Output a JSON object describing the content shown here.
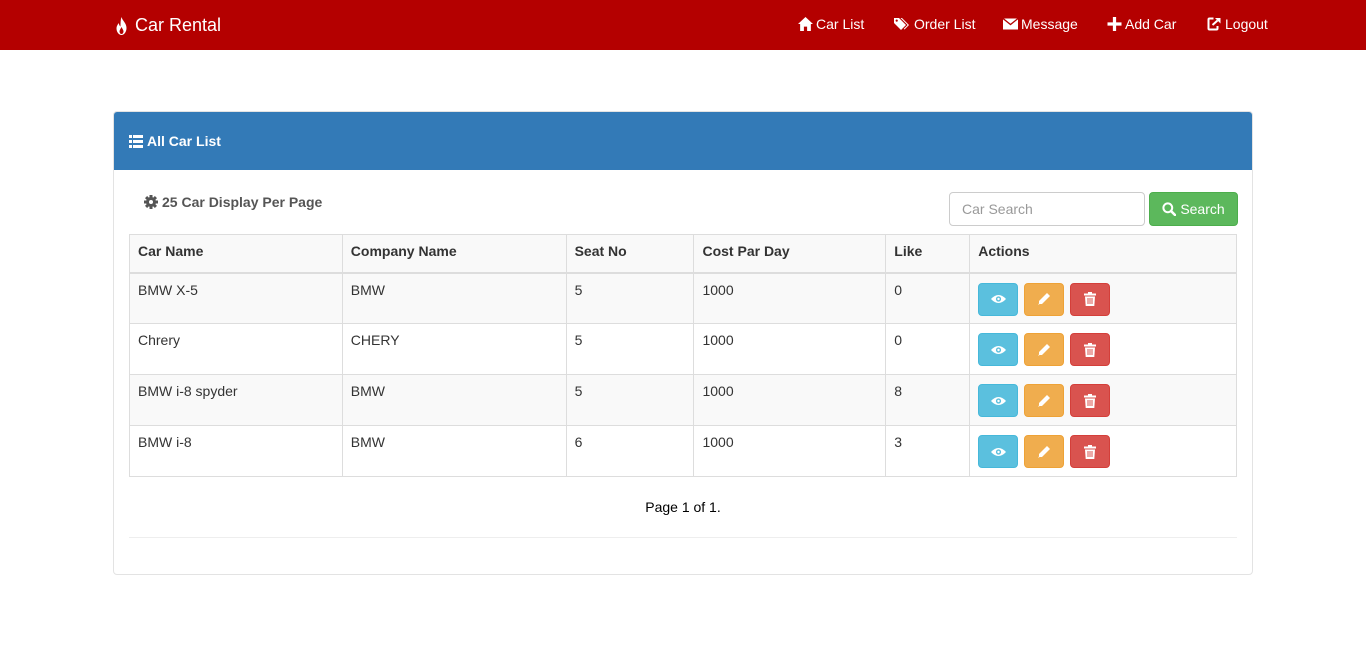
{
  "navbar": {
    "brand": "Car Rental",
    "links": [
      {
        "label": "Car List",
        "icon": "home-icon"
      },
      {
        "label": "Order List",
        "icon": "tags-icon"
      },
      {
        "label": "Message",
        "icon": "envelope-icon"
      },
      {
        "label": "Add Car",
        "icon": "plus-icon"
      },
      {
        "label": "Logout",
        "icon": "logout-icon"
      }
    ]
  },
  "panel": {
    "title": "All Car List",
    "per_page": "25 Car Display Per Page",
    "search_placeholder": "Car Search",
    "search_label": "Search"
  },
  "table": {
    "headers": [
      "Car Name",
      "Company Name",
      "Seat No",
      "Cost Par Day",
      "Like",
      "Actions"
    ],
    "rows": [
      [
        "BMW X-5",
        "BMW",
        "5",
        "1000",
        "0"
      ],
      [
        "Chrery",
        "CHERY",
        "5",
        "1000",
        "0"
      ],
      [
        "BMW i-8 spyder",
        "BMW",
        "5",
        "1000",
        "8"
      ],
      [
        "BMW i-8",
        "BMW",
        "6",
        "1000",
        "3"
      ]
    ]
  },
  "pagination": "Page 1 of 1.",
  "colors": {
    "navbar": "#b40000",
    "panel_heading": "#337ab7",
    "success": "#5cb85c",
    "info": "#5bc0de",
    "warning": "#f0ad4e",
    "danger": "#d9534f"
  }
}
